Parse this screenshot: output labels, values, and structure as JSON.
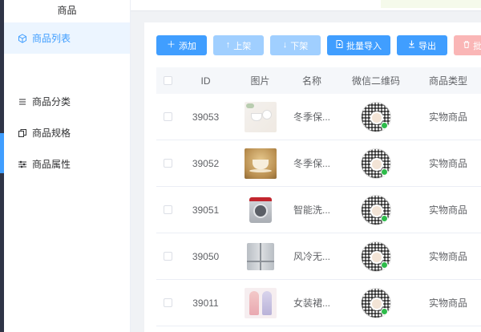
{
  "sidebar": {
    "title": "商品",
    "items": [
      {
        "label": "商品列表",
        "icon": "cube-icon",
        "active": true
      },
      {
        "label": "商品分类",
        "icon": "list-icon",
        "active": false
      },
      {
        "label": "商品规格",
        "icon": "copy-icon",
        "active": false
      },
      {
        "label": "商品属性",
        "icon": "sliders-icon",
        "active": false
      }
    ]
  },
  "toolbar": {
    "add": "添加",
    "on_shelf": "上架",
    "off_shelf": "下架",
    "batch_import": "批量导入",
    "export": "导出",
    "delete": "批"
  },
  "table": {
    "headers": {
      "id": "ID",
      "image": "图片",
      "name": "名称",
      "qr": "微信二维码",
      "type": "商品类型"
    },
    "rows": [
      {
        "id": "39053",
        "name": "冬季保...",
        "type": "实物商品",
        "image": "tea-set"
      },
      {
        "id": "39052",
        "name": "冬季保...",
        "type": "实物商品",
        "image": "cups"
      },
      {
        "id": "39051",
        "name": "智能洗...",
        "type": "实物商品",
        "image": "washing-machine"
      },
      {
        "id": "39050",
        "name": "风冷无...",
        "type": "实物商品",
        "image": "refrigerator"
      },
      {
        "id": "39011",
        "name": "女装裙...",
        "type": "实物商品",
        "image": "dresses"
      }
    ]
  },
  "colors": {
    "primary": "#409eff",
    "primary_disabled": "#a0cfff",
    "danger_disabled": "#fab6b6",
    "active_bg": "#ecf5ff"
  }
}
